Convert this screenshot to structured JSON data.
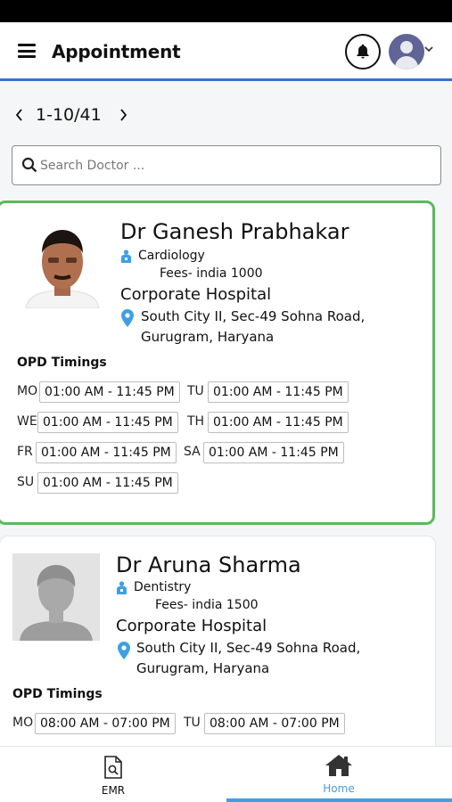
{
  "header": {
    "title": "Appointment",
    "menu_icon": "hamburger-menu-icon",
    "notification_icon": "bell-icon",
    "avatar_icon": "user-avatar-icon"
  },
  "pagination": {
    "text": "1-10/41"
  },
  "search": {
    "placeholder": "Search Doctor ..."
  },
  "doctors": [
    {
      "name": "Dr Ganesh Prabhakar",
      "specialty": "Cardiology",
      "fees": "Fees- india 1000",
      "hospital": "Corporate Hospital",
      "address_line1": "South City II, Sec-49 Sohna Road,",
      "address_line2": "Gurugram, Haryana",
      "opd_label": "OPD Timings",
      "timings": [
        {
          "day": "MO",
          "time": "01:00 AM - 11:45 PM"
        },
        {
          "day": "TU",
          "time": "01:00 AM - 11:45 PM"
        },
        {
          "day": "WE",
          "time": "01:00 AM - 11:45 PM"
        },
        {
          "day": "TH",
          "time": "01:00 AM - 11:45 PM"
        },
        {
          "day": "FR",
          "time": "01:00 AM - 11:45 PM"
        },
        {
          "day": "SA",
          "time": "01:00 AM - 11:45 PM"
        },
        {
          "day": "SU",
          "time": "01:00 AM - 11:45 PM"
        }
      ]
    },
    {
      "name": "Dr Aruna Sharma",
      "specialty": "Dentistry",
      "fees": "Fees- india 1500",
      "hospital": "Corporate Hospital",
      "address_line1": "South City II, Sec-49 Sohna Road,",
      "address_line2": "Gurugram, Haryana",
      "opd_label": "OPD Timings",
      "timings": [
        {
          "day": "MO",
          "time": "08:00 AM - 07:00 PM"
        },
        {
          "day": "TU",
          "time": "08:00 AM - 07:00 PM"
        }
      ]
    }
  ],
  "bottom_nav": {
    "emr_label": "EMR",
    "home_label": "Home",
    "active": "Home"
  },
  "colors": {
    "accent": "#3b6fd9",
    "selected_border": "#5cb85c",
    "pin": "#3ea0e3",
    "home_active": "#4a9be0"
  }
}
